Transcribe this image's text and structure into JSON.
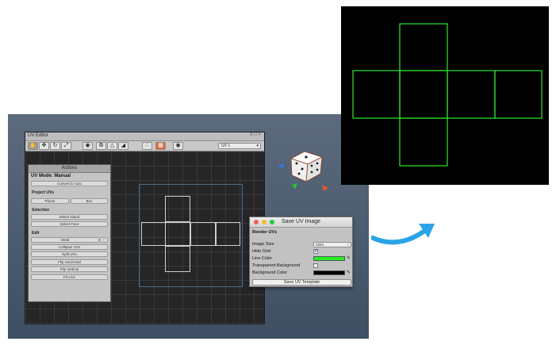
{
  "uv_editor": {
    "title": "UV Editor",
    "title_controls": "≡ □ ×",
    "uv_channel": "UV 1",
    "toolbar_icons": [
      "hand-icon",
      "move-icon",
      "rotate-icon",
      "scale-icon",
      "vertex-mode-icon",
      "edge-mode-icon",
      "face-mode-icon",
      "select-icon",
      "texture-icon",
      "nodes-icon",
      "checker-icon",
      "screenshot-icon"
    ]
  },
  "actions": {
    "header": "Actions",
    "mode": "UV Mode: Manual",
    "convert_label": "Convert to Auto",
    "project_heading": "Project UVs",
    "planar_label": "Planar",
    "box_label": "Box",
    "selection_heading": "Selection",
    "select_island_label": "Select Island",
    "select_face_label": "Select Face",
    "edit_heading": "Edit",
    "weld_label": "Weld",
    "weld_plus_label": "+",
    "collapse_label": "Collapse UVs",
    "split_label": "Split UVs",
    "flip_h_label": "Flip Horizontal",
    "flip_v_label": "Flip Vertical",
    "fit_label": "Fit UVs"
  },
  "save_dialog": {
    "title": "Save UV Image",
    "heading": "Render UVs",
    "image_size_label": "Image Size",
    "image_size_value": "1024",
    "hide_grid_label": "Hide Grid",
    "hide_grid_checked": true,
    "hide_grid_mark": "✔",
    "line_color_label": "Line Color",
    "line_color": "#22ee22",
    "transparent_bg_label": "Transparent Background",
    "transparent_bg_checked": false,
    "background_color_label": "Background Color",
    "background_color": "#000000",
    "save_button_label": "Save UV Template"
  },
  "colors": {
    "output_line": "#2fe82f",
    "output_background": "#000000",
    "arrow": "#2aa4e6",
    "close_button": "#ee5f57",
    "minimize_button": "#f6be2f",
    "zoom_button": "#29c840"
  }
}
